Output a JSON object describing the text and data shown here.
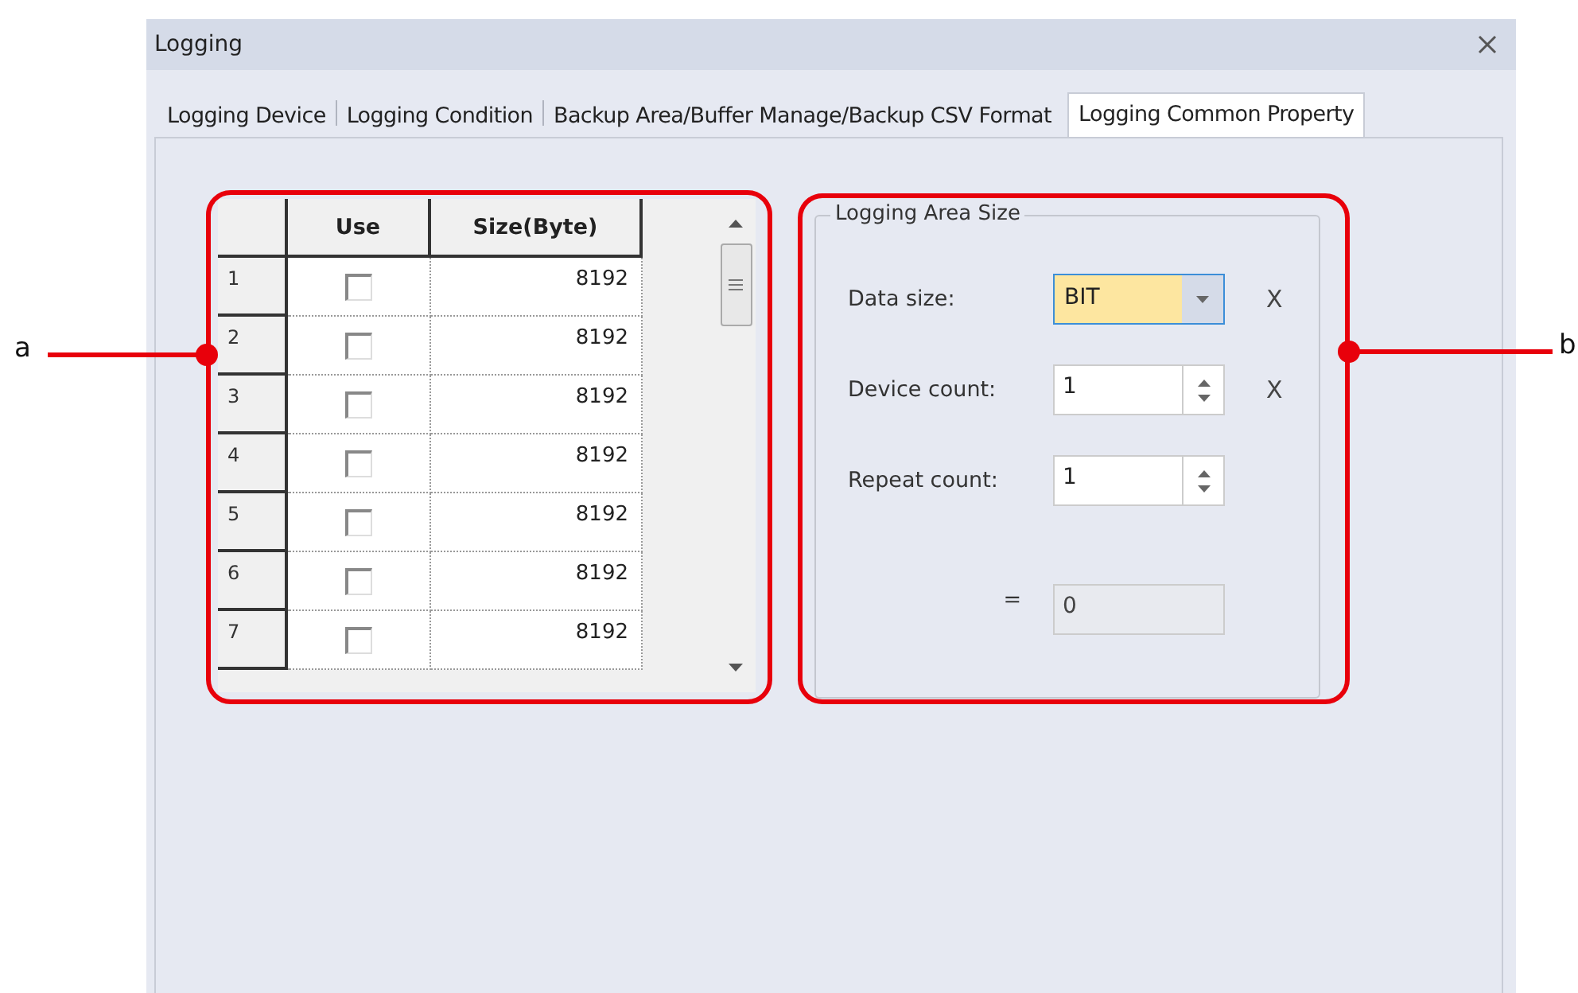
{
  "window": {
    "title": "Logging"
  },
  "tabs": [
    {
      "label": "Logging Device",
      "selected": false
    },
    {
      "label": "Logging Condition",
      "selected": false
    },
    {
      "label": "Backup Area/Buffer Manage/Backup CSV Format",
      "selected": false
    },
    {
      "label": "Logging Common Property",
      "selected": true
    }
  ],
  "table": {
    "columns": [
      "Use",
      "Size(Byte)"
    ],
    "rows": [
      {
        "index": "1",
        "checked": false,
        "size": "8192"
      },
      {
        "index": "2",
        "checked": false,
        "size": "8192"
      },
      {
        "index": "3",
        "checked": false,
        "size": "8192"
      },
      {
        "index": "4",
        "checked": false,
        "size": "8192"
      },
      {
        "index": "5",
        "checked": false,
        "size": "8192"
      },
      {
        "index": "6",
        "checked": false,
        "size": "8192"
      },
      {
        "index": "7",
        "checked": false,
        "size": "8192"
      }
    ]
  },
  "logging_area_size": {
    "title": "Logging Area Size",
    "fields": [
      {
        "kind": "dropdown",
        "label": "Data size:",
        "value": "BIT",
        "suffix": "X"
      },
      {
        "kind": "spinner",
        "label": "Device count:",
        "value": "1",
        "suffix": "X"
      },
      {
        "kind": "spinner",
        "label": "Repeat count:",
        "value": "1"
      },
      {
        "kind": "readonly",
        "label": "=",
        "value": "0"
      }
    ]
  },
  "callouts": [
    {
      "label": "a"
    },
    {
      "label": "b"
    }
  ]
}
